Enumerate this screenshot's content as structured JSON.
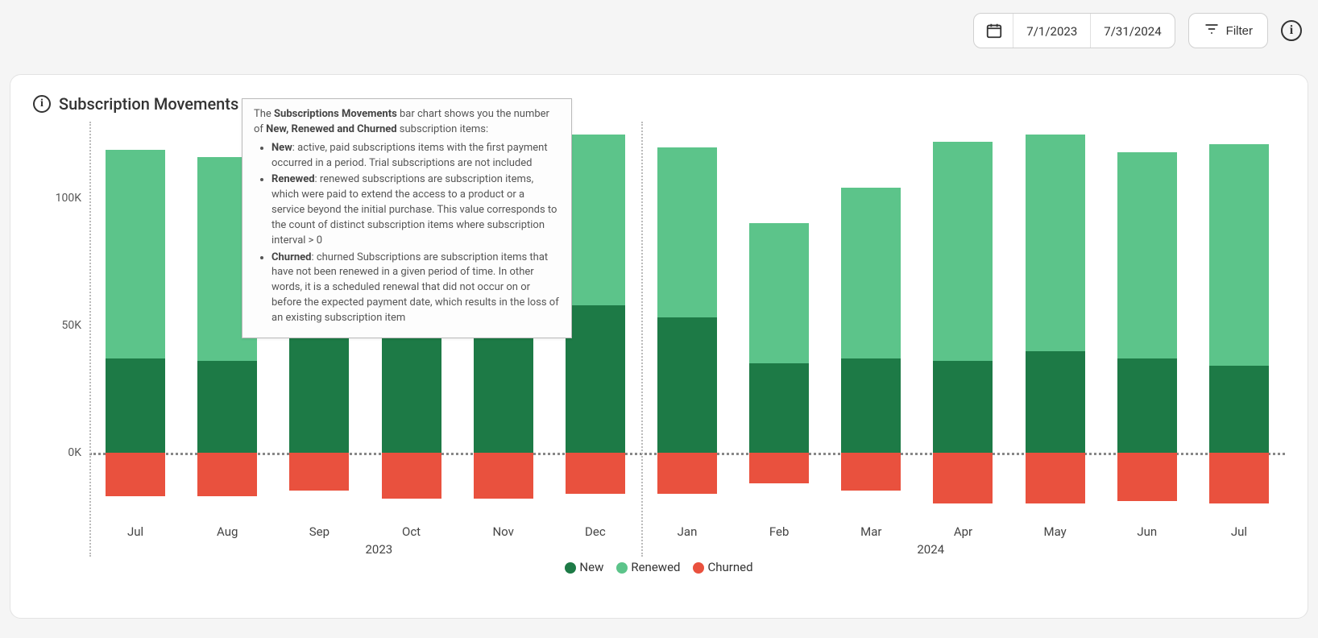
{
  "toolbar": {
    "date_from": "7/1/2023",
    "date_to": "7/31/2024",
    "filter_label": "Filter"
  },
  "card": {
    "title": "Subscription Movements"
  },
  "tooltip": {
    "intro_a": "The ",
    "intro_title": "Subscriptions Movements",
    "intro_b": " bar chart shows you the number of ",
    "intro_terms": "New, Renewed and Churned",
    "intro_c": " subscription items:",
    "new_label": "New",
    "new_text": ": active, paid subscriptions items with the first payment occurred in a period. Trial subscriptions are not included",
    "renewed_label": "Renewed",
    "renewed_text": ": renewed subscriptions are subscription items, which were paid to extend the access to a product or a service beyond the initial purchase. This value corresponds to the count of distinct subscription items where subscription interval > 0",
    "churned_label": "Churned",
    "churned_text": ": churned Subscriptions are subscription items that have not been renewed in a given period of time. In other words, it is a scheduled renewal that did not occur on or before the expected payment date, which results in the loss of an existing subscription item"
  },
  "legend": {
    "new": "New",
    "renewed": "Renewed",
    "churned": "Churned"
  },
  "colors": {
    "new": "#1d7a46",
    "renewed": "#5cc48a",
    "churned": "#e9513e"
  },
  "chart_data": {
    "type": "bar",
    "title": "Subscription Movements",
    "xlabel": "",
    "ylabel": "",
    "ylim": [
      -25000,
      130000
    ],
    "y_ticks": [
      0,
      50000,
      100000
    ],
    "y_tick_labels": [
      "0K",
      "50K",
      "100K"
    ],
    "categories": [
      "Jul",
      "Aug",
      "Sep",
      "Oct",
      "Nov",
      "Dec",
      "Jan",
      "Feb",
      "Mar",
      "Apr",
      "May",
      "Jun",
      "Jul"
    ],
    "year_breaks": [
      {
        "after_index": 0,
        "label": "2023"
      },
      {
        "after_index": 6,
        "label": "2024"
      }
    ],
    "series": [
      {
        "name": "New",
        "color": "#1d7a46",
        "values": [
          37000,
          36000,
          45000,
          55000,
          57000,
          58000,
          53000,
          35000,
          37000,
          36000,
          40000,
          37000,
          34000
        ]
      },
      {
        "name": "Renewed",
        "color": "#5cc48a",
        "values": [
          82000,
          80000,
          11000,
          70000,
          68000,
          67000,
          67000,
          55000,
          67000,
          86000,
          85000,
          81000,
          87000
        ]
      },
      {
        "name": "Churned",
        "color": "#e9513e",
        "values": [
          -17000,
          -17000,
          -15000,
          -18000,
          -18000,
          -16000,
          -16000,
          -12000,
          -15000,
          -20000,
          -20000,
          -19000,
          -20000
        ]
      }
    ]
  }
}
